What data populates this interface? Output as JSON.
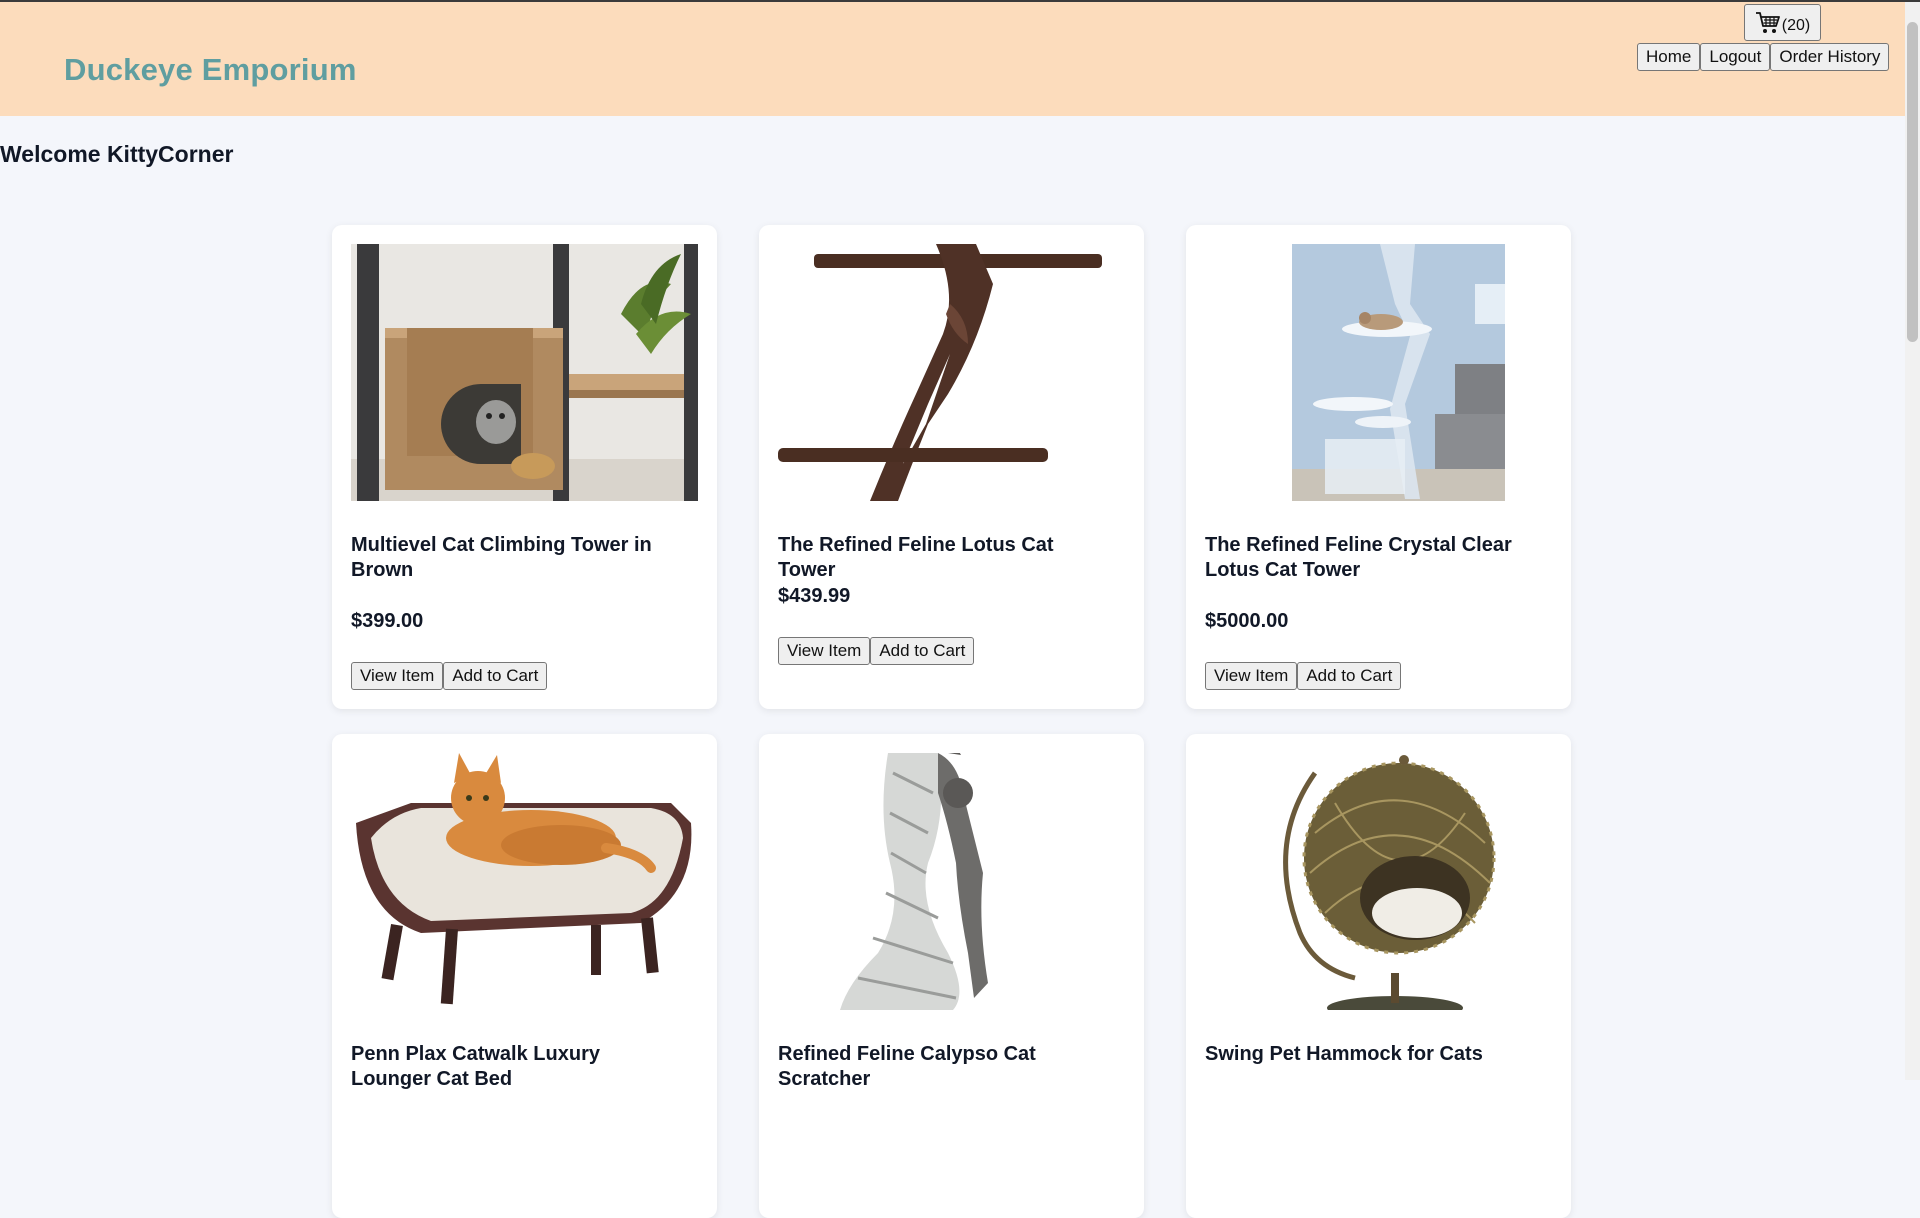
{
  "header": {
    "brand": "Duckeye Emporium",
    "background_color": "#fcdcbc",
    "brand_color": "#5f9ea0",
    "cart_icon": "shopping-cart-icon",
    "cart_count": "(20)",
    "nav": [
      "Home",
      "Logout",
      "Order History"
    ]
  },
  "welcome": "Welcome KittyCorner",
  "products": [
    {
      "title": "Multievel Cat Climbing Tower in Brown",
      "price": "$399.00",
      "image": "cat-climbing-tower-photo",
      "view_label": "View Item",
      "add_label": "Add to Cart"
    },
    {
      "title": "The Refined Feline Lotus Cat Tower",
      "price": "$439.99",
      "image": "lotus-cat-tower-photo",
      "view_label": "View Item",
      "add_label": "Add to Cart"
    },
    {
      "title": "The Refined Feline Crystal Clear Lotus Cat Tower",
      "price": "$5000.00",
      "image": "crystal-clear-cat-tower-photo",
      "view_label": "View Item",
      "add_label": "Add to Cart"
    },
    {
      "title": "Penn Plax Catwalk Luxury Lounger Cat Bed",
      "image": "cat-lounger-bed-photo"
    },
    {
      "title": "Refined Feline Calypso Cat Scratcher",
      "image": "cat-scratcher-photo"
    },
    {
      "title": "Swing Pet Hammock for Cats",
      "image": "pet-hammock-photo"
    }
  ]
}
